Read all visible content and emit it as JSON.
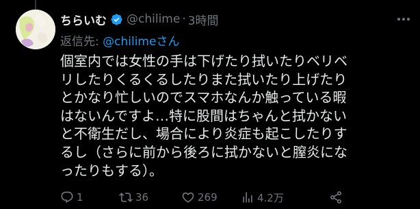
{
  "tweet": {
    "author_name": "ちらいむ",
    "handle": "@chilime",
    "separator": "·",
    "time": "3時間",
    "reply_prefix": "返信先: ",
    "reply_handle": "@chilimeさん",
    "body_lines": [
      "個室内では女性の手は下げたり拭いたりベリベ",
      "リしたりくるくるしたりまた拭いたり上げたり",
      "とかなり忙しいのでスマホなんか触っている暇",
      "はないんですよ…特に股間はちゃんと拭かない",
      "と不衛生だし、場合により炎症も起こしたりす",
      "るし（さらに前から後ろに拭かないと膣炎にな",
      "ったりもする）。"
    ]
  },
  "actions": {
    "replies": "1",
    "retweets": "36",
    "likes": "269",
    "views": "4.2万"
  },
  "icons": {
    "verified": "verified-badge-icon",
    "more": "more-icon",
    "reply": "reply-icon",
    "retweet": "retweet-icon",
    "like": "heart-icon",
    "views": "views-icon",
    "share": "share-icon"
  },
  "colors": {
    "background": "#000000",
    "text": "#e7e9ea",
    "secondary": "#71767b",
    "accent": "#1d9bf0"
  }
}
